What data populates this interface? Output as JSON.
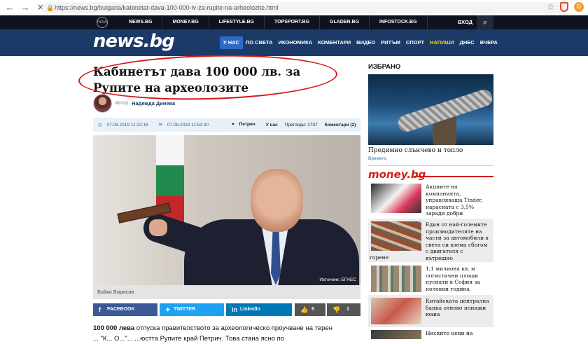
{
  "browser": {
    "back": "←",
    "forward": "→",
    "reload": "✕",
    "url": "https://news.bg/bulgaria/kabinetat-dava-100-000-lv-za-rupite-na-arheolozite.html",
    "profile_initial": "G"
  },
  "topnav": {
    "globe_label": "NEWS",
    "links": [
      "NEWS.BG",
      "MONEY.BG",
      "LIFESTYLE.BG",
      "TOPSPORT.BG",
      "GLADEN.BG",
      "INFOSTOCK.BG"
    ],
    "login": "ВХОД"
  },
  "mainnav": {
    "logo": "news.bg",
    "items": [
      "У НАС",
      "ПО СВЕТА",
      "ИКОНОМИКА",
      "КОМЕНТАРИ",
      "ВИДЕО",
      "РИТЪМ",
      "СПОРТ",
      "НАПИШИ",
      "ДНЕС",
      "ВЧЕРА"
    ]
  },
  "article": {
    "title": "Кабинетът дава 100 000 лв. за Рупите на археолозите",
    "author_label": "Автор:",
    "author_name": "Надежда Динева",
    "published": "07.08.2019 11:22:16",
    "updated": "07.08.2019 11:53:30",
    "location": "Петрич",
    "category": "У нас",
    "views": "Прегледи: 1737",
    "comments": "Коментари (2)",
    "photo_source": "Източник: БГНЕС",
    "caption": "Бойко Борисов",
    "share": {
      "facebook": "FACEBOOK",
      "twitter": "TWITTER",
      "linkedin": "LinkedIn",
      "likes": "5",
      "dislikes": "1"
    },
    "lead_bold": "100 000 лева",
    "lead_rest": " отпуска правителството за археологическо проучване на терен",
    "line2": "... \"К... О...\"... ...юстта Рупите край Петрич. Това стана ясно по"
  },
  "sidebar": {
    "title": "ИЗБРАНО",
    "featured_headline": "Предимно слънчево и топло",
    "featured_tag": "Времето",
    "money_logo": "money.bg",
    "news": [
      {
        "text": "Акциите на компанията, управляваща Tinder, нарасната с 3,5% заради добри тримесечни резултати",
        "below": ""
      },
      {
        "text": "Един от най-големите производителите на части за автомобили в света си взема сбогом с двигателя с вътрешно",
        "below": "горене"
      },
      {
        "text": "1,1 милиона кв. м логистични площи пуснати в София за половин година",
        "below": ""
      },
      {
        "text": "Китайската централна банка отново понижи юана",
        "below": ""
      },
      {
        "text": "Ниските цени на петрола накарат повече щети на",
        "below": ""
      }
    ]
  },
  "colors": {
    "topnav_bg": "#0f1320",
    "mainnav_bg": "#1c3a68",
    "active_tab": "#2e6bc4",
    "highlight_circle": "#d21a1a",
    "facebook": "#3b5998",
    "twitter": "#1da1f2",
    "linkedin": "#0077b5"
  }
}
